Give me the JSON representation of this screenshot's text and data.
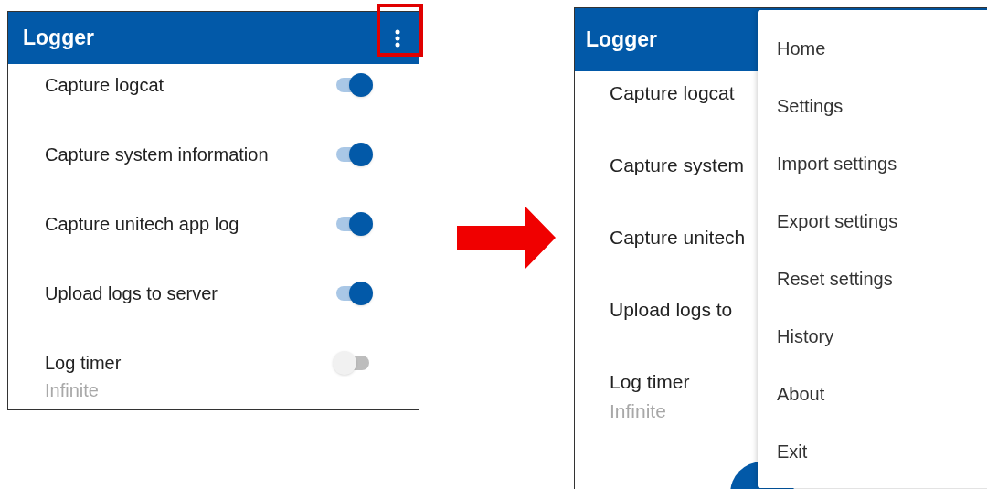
{
  "before": {
    "title": "Logger",
    "settings": [
      {
        "label": "Capture logcat",
        "on": true
      },
      {
        "label": "Capture system information",
        "on": true
      },
      {
        "label": "Capture unitech app log",
        "on": true
      },
      {
        "label": "Upload logs to server",
        "on": true
      },
      {
        "label": "Log timer",
        "summary": "Infinite",
        "on": false
      }
    ]
  },
  "after": {
    "title": "Logger",
    "settings": [
      {
        "label": "Capture logcat"
      },
      {
        "label": "Capture system"
      },
      {
        "label": "Capture unitech"
      },
      {
        "label": "Upload logs to"
      },
      {
        "label": "Log timer",
        "summary": "Infinite"
      }
    ],
    "menu": [
      "Home",
      "Settings",
      "Import settings",
      "Export settings",
      "Reset settings",
      "History",
      "About",
      "Exit"
    ]
  }
}
